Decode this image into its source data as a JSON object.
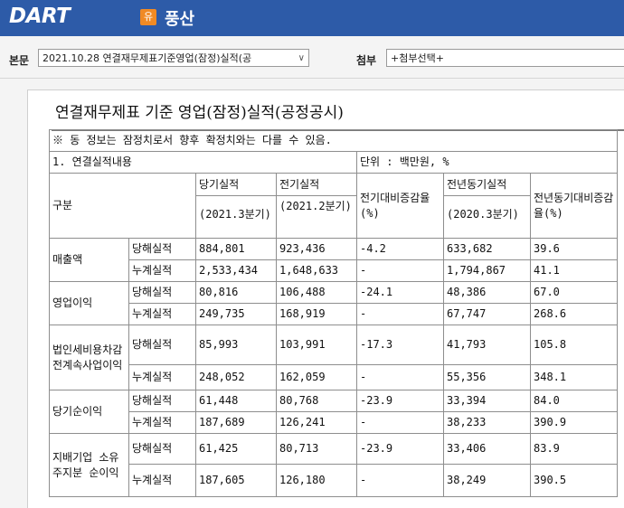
{
  "header": {
    "logo": "DART",
    "badge": "유",
    "company": "풍산"
  },
  "toolbar": {
    "report_label": "본문",
    "report_value": "2021.10.28  연결재무제표기준영업(잠정)실적(공",
    "attach_label": "첨부",
    "attach_value": "+첨부선택+"
  },
  "doc": {
    "title": "연결재무제표 기준 영업(잠정)실적(공정공시)",
    "notice": "※ 동 정보는 잠정치로서 향후 확정치와는 다를 수 있음.",
    "section": "1. 연결실적내용",
    "unit": "단위 : 백만원, %"
  },
  "table": {
    "col_gubun": "구분",
    "col_cur": "당기실적",
    "col_cur_period": "(2021.3분기)",
    "col_prev": "전기실적",
    "col_prev_period": "(2021.2분기)",
    "col_prev_rate": "전기대비증감율(%)",
    "col_yoy": "전년동기실적",
    "col_yoy_period": "(2020.3분기)",
    "col_yoy_rate": "전년동기대비증감율(%)",
    "groups": [
      {
        "name": "매출액",
        "rows": [
          {
            "type": "당해실적",
            "cur": "884,801",
            "prev": "923,436",
            "prev_rate": "-4.2",
            "yoy": "633,682",
            "yoy_rate": "39.6"
          },
          {
            "type": "누계실적",
            "cur": "2,533,434",
            "prev": "1,648,633",
            "prev_rate": "-",
            "yoy": "1,794,867",
            "yoy_rate": "41.1"
          }
        ]
      },
      {
        "name": "영업이익",
        "rows": [
          {
            "type": "당해실적",
            "cur": "80,816",
            "prev": "106,488",
            "prev_rate": "-24.1",
            "yoy": "48,386",
            "yoy_rate": "67.0"
          },
          {
            "type": "누계실적",
            "cur": "249,735",
            "prev": "168,919",
            "prev_rate": "-",
            "yoy": "67,747",
            "yoy_rate": "268.6"
          }
        ]
      },
      {
        "name": "법인세비용차감전계속사업이익",
        "rows": [
          {
            "type": "당해실적",
            "cur": "85,993",
            "prev": "103,991",
            "prev_rate": "-17.3",
            "yoy": "41,793",
            "yoy_rate": "105.8"
          },
          {
            "type": "누계실적",
            "cur": "248,052",
            "prev": "162,059",
            "prev_rate": "-",
            "yoy": "55,356",
            "yoy_rate": "348.1"
          }
        ]
      },
      {
        "name": "당기순이익",
        "rows": [
          {
            "type": "당해실적",
            "cur": "61,448",
            "prev": "80,768",
            "prev_rate": "-23.9",
            "yoy": "33,394",
            "yoy_rate": "84.0"
          },
          {
            "type": "누계실적",
            "cur": "187,689",
            "prev": "126,241",
            "prev_rate": "-",
            "yoy": "38,233",
            "yoy_rate": "390.9"
          }
        ]
      },
      {
        "name": "지배기업 소유주지분 순이익",
        "rows": [
          {
            "type": "당해실적",
            "cur": "61,425",
            "prev": "80,713",
            "prev_rate": "-23.9",
            "yoy": "33,406",
            "yoy_rate": "83.9"
          },
          {
            "type": "누계실적",
            "cur": "187,605",
            "prev": "126,180",
            "prev_rate": "-",
            "yoy": "38,249",
            "yoy_rate": "390.5"
          }
        ]
      }
    ]
  },
  "colors": {
    "topbar": "#2d5ba8",
    "badge": "#f08a24"
  }
}
